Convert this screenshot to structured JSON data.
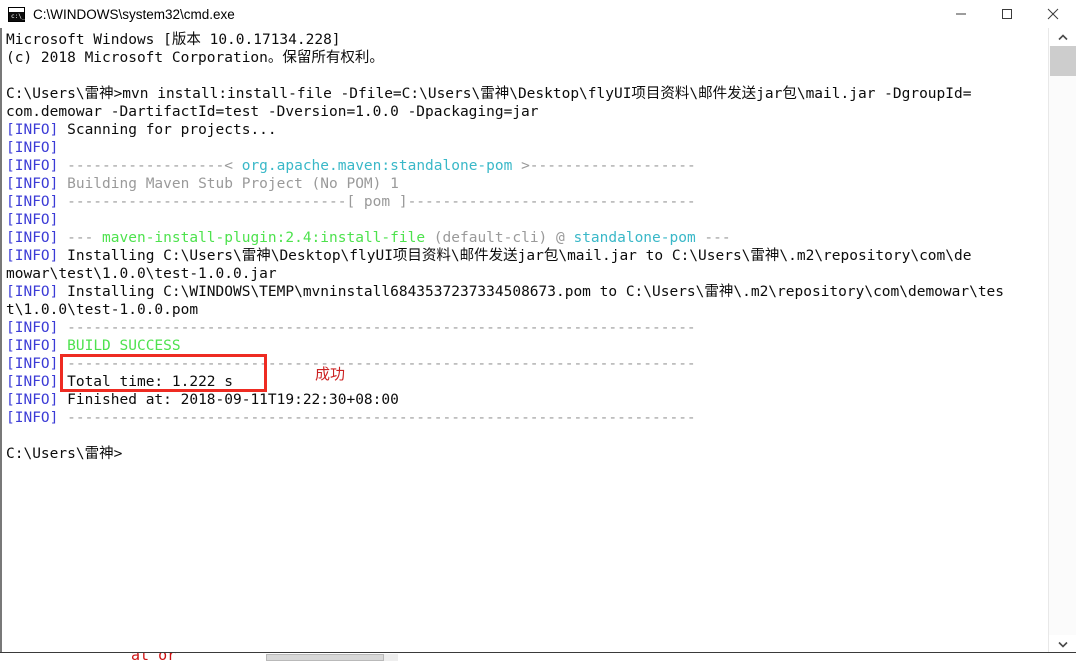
{
  "window": {
    "title": "C:\\WINDOWS\\system32\\cmd.exe",
    "icon": "cmd-icon",
    "buttons": {
      "minimize": "minimize-button",
      "maximize": "maximize-button",
      "close": "close-button"
    }
  },
  "colors": {
    "info": "#3b3bd6",
    "gray": "#9a9a9a",
    "green": "#4ee24e",
    "cyan": "#3ab8c8",
    "plain": "#0c0c0c",
    "annotation_red": "#ee2b22",
    "background": "#ffffff"
  },
  "console": {
    "lines": [
      {
        "id": "l01",
        "segments": [
          {
            "text": "Microsoft Windows [版本 10.0.17134.228]",
            "color": "plain"
          }
        ]
      },
      {
        "id": "l02",
        "segments": [
          {
            "text": "(c) 2018 Microsoft Corporation。保留所有权利。",
            "color": "plain"
          }
        ]
      },
      {
        "id": "l03",
        "segments": [
          {
            "text": "",
            "color": "plain"
          }
        ]
      },
      {
        "id": "l04",
        "segments": [
          {
            "text": "C:\\Users\\雷神>mvn install:install-file -Dfile=C:\\Users\\雷神\\Desktop\\flyUI项目资料\\邮件发送jar包\\mail.jar -DgroupId=",
            "color": "plain"
          }
        ]
      },
      {
        "id": "l05",
        "segments": [
          {
            "text": "com.demowar -DartifactId=test -Dversion=1.0.0 -Dpackaging=jar",
            "color": "plain"
          }
        ]
      },
      {
        "id": "l06",
        "segments": [
          {
            "text": "[INFO]",
            "color": "info"
          },
          {
            "text": " Scanning for projects...",
            "color": "plain"
          }
        ]
      },
      {
        "id": "l07",
        "segments": [
          {
            "text": "[INFO]",
            "color": "info"
          }
        ]
      },
      {
        "id": "l08",
        "segments": [
          {
            "text": "[INFO]",
            "color": "info"
          },
          {
            "text": " ------------------< ",
            "color": "gray"
          },
          {
            "text": "org.apache.maven:standalone-pom",
            "color": "cyan"
          },
          {
            "text": " >-------------------",
            "color": "gray"
          }
        ]
      },
      {
        "id": "l09",
        "segments": [
          {
            "text": "[INFO]",
            "color": "info"
          },
          {
            "text": " Building Maven Stub Project (No POM) 1",
            "color": "gray"
          }
        ]
      },
      {
        "id": "l10",
        "segments": [
          {
            "text": "[INFO]",
            "color": "info"
          },
          {
            "text": " --------------------------------[ pom ]---------------------------------",
            "color": "gray"
          }
        ]
      },
      {
        "id": "l11",
        "segments": [
          {
            "text": "[INFO]",
            "color": "info"
          }
        ]
      },
      {
        "id": "l12",
        "segments": [
          {
            "text": "[INFO]",
            "color": "info"
          },
          {
            "text": " --- ",
            "color": "gray"
          },
          {
            "text": "maven-install-plugin:2.4:install-file",
            "color": "green"
          },
          {
            "text": " (default-cli) @ ",
            "color": "gray"
          },
          {
            "text": "standalone-pom",
            "color": "cyan"
          },
          {
            "text": " ---",
            "color": "gray"
          }
        ]
      },
      {
        "id": "l13",
        "segments": [
          {
            "text": "[INFO]",
            "color": "info"
          },
          {
            "text": " Installing C:\\Users\\雷神\\Desktop\\flyUI项目资料\\邮件发送jar包\\mail.jar to C:\\Users\\雷神\\.m2\\repository\\com\\de",
            "color": "plain"
          }
        ]
      },
      {
        "id": "l14",
        "segments": [
          {
            "text": "mowar\\test\\1.0.0\\test-1.0.0.jar",
            "color": "plain"
          }
        ]
      },
      {
        "id": "l15",
        "segments": [
          {
            "text": "[INFO]",
            "color": "info"
          },
          {
            "text": " Installing C:\\WINDOWS\\TEMP\\mvninstall6843537237334508673.pom to C:\\Users\\雷神\\.m2\\repository\\com\\demowar\\tes",
            "color": "plain"
          }
        ]
      },
      {
        "id": "l16",
        "segments": [
          {
            "text": "t\\1.0.0\\test-1.0.0.pom",
            "color": "plain"
          }
        ]
      },
      {
        "id": "l17",
        "segments": [
          {
            "text": "[INFO]",
            "color": "info"
          },
          {
            "text": " ------------------------------------------------------------------------",
            "color": "gray"
          }
        ]
      },
      {
        "id": "l18",
        "segments": [
          {
            "text": "[INFO]",
            "color": "info"
          },
          {
            "text": " ",
            "color": "plain"
          },
          {
            "text": "BUILD SUCCESS",
            "color": "green"
          }
        ]
      },
      {
        "id": "l19",
        "segments": [
          {
            "text": "[INFO]",
            "color": "info"
          },
          {
            "text": " ------------------------------------------------------------------------",
            "color": "gray"
          }
        ]
      },
      {
        "id": "l20",
        "segments": [
          {
            "text": "[INFO]",
            "color": "info"
          },
          {
            "text": " Total time: 1.222 s",
            "color": "plain"
          }
        ]
      },
      {
        "id": "l21",
        "segments": [
          {
            "text": "[INFO]",
            "color": "info"
          },
          {
            "text": " Finished at: 2018-09-11T19:22:30+08:00",
            "color": "plain"
          }
        ]
      },
      {
        "id": "l22",
        "segments": [
          {
            "text": "[INFO]",
            "color": "info"
          },
          {
            "text": " ------------------------------------------------------------------------",
            "color": "gray"
          }
        ]
      },
      {
        "id": "l23",
        "segments": [
          {
            "text": "",
            "color": "plain"
          }
        ]
      },
      {
        "id": "l24",
        "segments": [
          {
            "text": "C:\\Users\\雷神>",
            "color": "plain"
          }
        ]
      }
    ]
  },
  "annotations": {
    "highlight_target": "BUILD SUCCESS",
    "note_text": "成功"
  },
  "scrollbar": {
    "up_arrow": "scroll-up-arrow",
    "down_arrow": "scroll-down-arrow",
    "thumb": "scroll-thumb"
  },
  "background_window": {
    "partial_text": "at or"
  }
}
